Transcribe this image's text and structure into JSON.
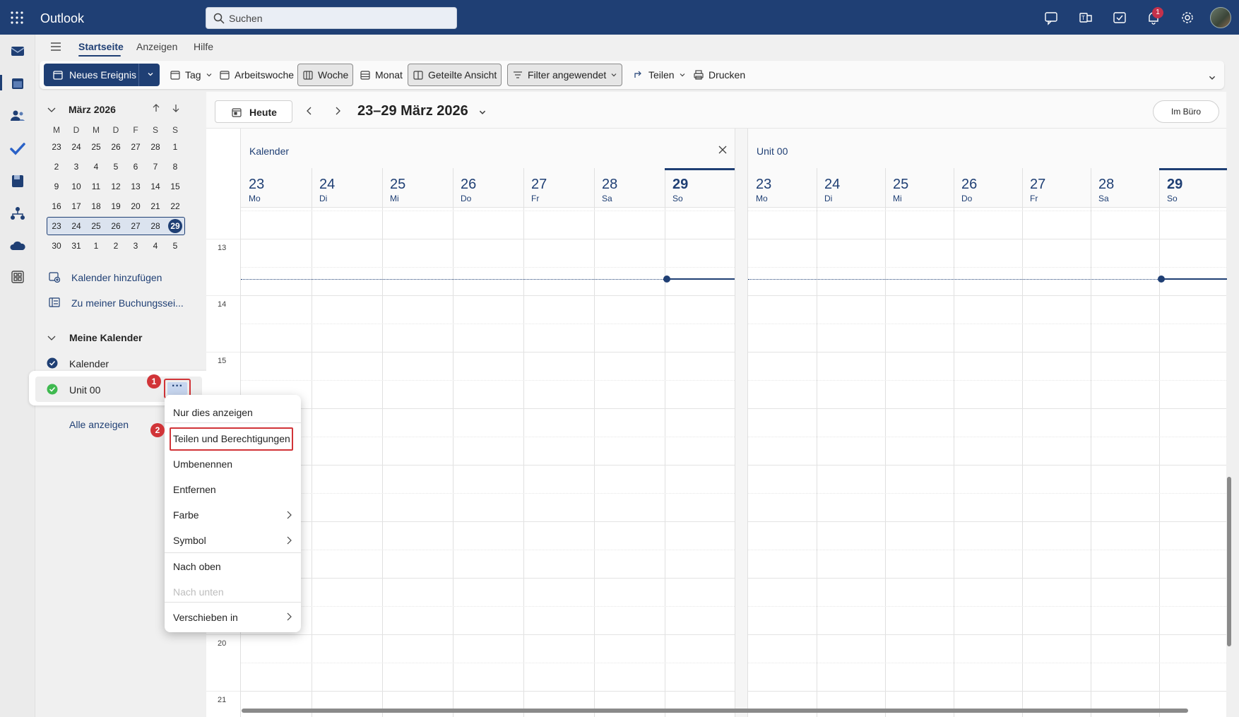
{
  "app": {
    "title": "Outlook",
    "notification_count": "1"
  },
  "search": {
    "placeholder": "Suchen"
  },
  "menu": {
    "tabs": [
      "Startseite",
      "Anzeigen",
      "Hilfe"
    ]
  },
  "ribbon": {
    "new_event": "Neues Ereignis",
    "day": "Tag",
    "work_week": "Arbeitswoche",
    "week": "Woche",
    "month": "Monat",
    "split_view": "Geteilte Ansicht",
    "filter": "Filter angewendet",
    "share": "Teilen",
    "print": "Drucken"
  },
  "mini_calendar": {
    "title": "März 2026",
    "weekday_headers": [
      "M",
      "D",
      "M",
      "D",
      "F",
      "S",
      "S"
    ],
    "weeks": [
      [
        "23",
        "24",
        "25",
        "26",
        "27",
        "28",
        "1"
      ],
      [
        "2",
        "3",
        "4",
        "5",
        "6",
        "7",
        "8"
      ],
      [
        "9",
        "10",
        "11",
        "12",
        "13",
        "14",
        "15"
      ],
      [
        "16",
        "17",
        "18",
        "19",
        "20",
        "21",
        "22"
      ],
      [
        "23",
        "24",
        "25",
        "26",
        "27",
        "28",
        "29"
      ],
      [
        "30",
        "31",
        "1",
        "2",
        "3",
        "4",
        "5"
      ]
    ]
  },
  "left_pane": {
    "add_calendar": "Kalender hinzufügen",
    "booking": "Zu meiner Buchungssei...",
    "my_calendars": "Meine Kalender",
    "calendar_1": "Kalender",
    "calendar_2": "Unit 00",
    "show_all": "Alle anzeigen",
    "more_label": "···",
    "step_1": "1",
    "step_2": "2"
  },
  "nav": {
    "today": "Heute",
    "date_range": "23–29 März 2026",
    "office": "Im Büro"
  },
  "calendars": [
    {
      "name": "Kalender",
      "days": [
        {
          "num": "23",
          "name": "Mo"
        },
        {
          "num": "24",
          "name": "Di"
        },
        {
          "num": "25",
          "name": "Mi"
        },
        {
          "num": "26",
          "name": "Do"
        },
        {
          "num": "27",
          "name": "Fr"
        },
        {
          "num": "28",
          "name": "Sa"
        },
        {
          "num": "29",
          "name": "So"
        }
      ]
    },
    {
      "name": "Unit 00",
      "days": [
        {
          "num": "23",
          "name": "Mo"
        },
        {
          "num": "24",
          "name": "Di"
        },
        {
          "num": "25",
          "name": "Mi"
        },
        {
          "num": "26",
          "name": "Do"
        },
        {
          "num": "27",
          "name": "Fr"
        },
        {
          "num": "28",
          "name": "Sa"
        },
        {
          "num": "29",
          "name": "So"
        }
      ]
    }
  ],
  "hours": [
    "13",
    "14",
    "15",
    "20",
    "21"
  ],
  "context_menu": {
    "items": [
      "Nur dies anzeigen",
      "Teilen und Berechtigungen",
      "Umbenennen",
      "Entfernen",
      "Farbe",
      "Symbol",
      "Nach oben",
      "Nach unten",
      "Verschieben in"
    ]
  },
  "colors": {
    "brand": "#1f3f74",
    "highlight": "#d13438",
    "calendar_green": "#3fb950"
  }
}
